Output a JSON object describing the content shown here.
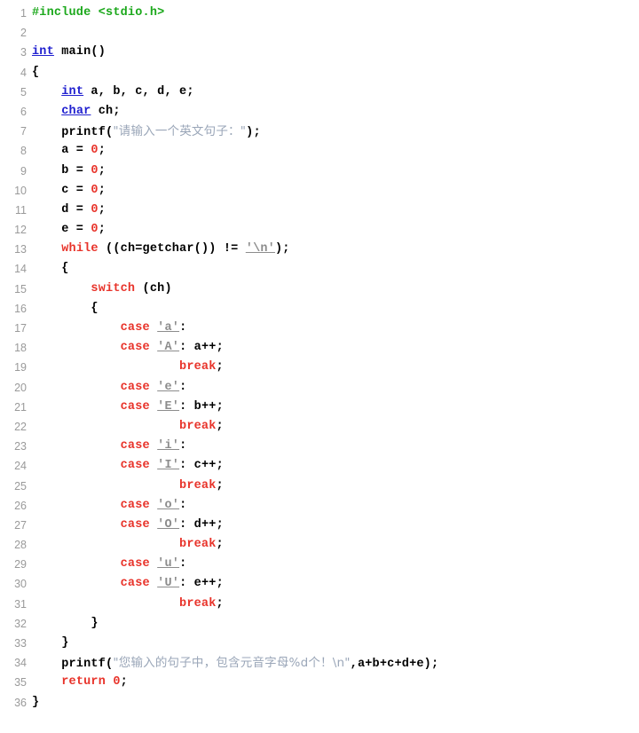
{
  "editor": {
    "language": "C",
    "title": "C Source Code Listing",
    "total_lines": 36,
    "colors": {
      "background": "#ffffff",
      "line_number": "#9a9a9a",
      "preprocessor": "#1ba81b",
      "type_keyword": "#2020cf",
      "control_keyword": "#e8332a",
      "number_literal": "#e8332a",
      "string_literal": "#9aa6b8",
      "char_literal": "#8c8c8c",
      "plain_text": "#000000"
    }
  },
  "lines": [
    {
      "n": "1",
      "tokens": [
        {
          "t": "#include <stdio.h>",
          "c": "t-pre"
        }
      ]
    },
    {
      "n": "2",
      "tokens": []
    },
    {
      "n": "3",
      "tokens": [
        {
          "t": "int",
          "c": "t-kw"
        },
        {
          "t": " main()",
          "c": "t-plain"
        }
      ]
    },
    {
      "n": "4",
      "tokens": [
        {
          "t": "{",
          "c": "t-plain"
        }
      ]
    },
    {
      "n": "5",
      "tokens": [
        {
          "t": "    ",
          "c": "t-plain"
        },
        {
          "t": "int",
          "c": "t-kw"
        },
        {
          "t": " a, b, c, d, e;",
          "c": "t-plain"
        }
      ]
    },
    {
      "n": "6",
      "tokens": [
        {
          "t": "    ",
          "c": "t-plain"
        },
        {
          "t": "char",
          "c": "t-kw"
        },
        {
          "t": " ch;",
          "c": "t-plain"
        }
      ]
    },
    {
      "n": "7",
      "tokens": [
        {
          "t": "    printf(",
          "c": "t-plain"
        },
        {
          "t": "\"请输入一个英文句子：\"",
          "c": "t-str t-cjk"
        },
        {
          "t": ");",
          "c": "t-plain"
        }
      ]
    },
    {
      "n": "8",
      "tokens": [
        {
          "t": "    a = ",
          "c": "t-plain"
        },
        {
          "t": "0",
          "c": "t-num"
        },
        {
          "t": ";",
          "c": "t-plain"
        }
      ]
    },
    {
      "n": "9",
      "tokens": [
        {
          "t": "    b = ",
          "c": "t-plain"
        },
        {
          "t": "0",
          "c": "t-num"
        },
        {
          "t": ";",
          "c": "t-plain"
        }
      ]
    },
    {
      "n": "10",
      "tokens": [
        {
          "t": "    c = ",
          "c": "t-plain"
        },
        {
          "t": "0",
          "c": "t-num"
        },
        {
          "t": ";",
          "c": "t-plain"
        }
      ]
    },
    {
      "n": "11",
      "tokens": [
        {
          "t": "    d = ",
          "c": "t-plain"
        },
        {
          "t": "0",
          "c": "t-num"
        },
        {
          "t": ";",
          "c": "t-plain"
        }
      ]
    },
    {
      "n": "12",
      "tokens": [
        {
          "t": "    e = ",
          "c": "t-plain"
        },
        {
          "t": "0",
          "c": "t-num"
        },
        {
          "t": ";",
          "c": "t-plain"
        }
      ]
    },
    {
      "n": "13",
      "tokens": [
        {
          "t": "    ",
          "c": "t-plain"
        },
        {
          "t": "while",
          "c": "t-ctl"
        },
        {
          "t": " ((ch=getchar()) != ",
          "c": "t-plain"
        },
        {
          "t": "'\\n'",
          "c": "t-chr"
        },
        {
          "t": ");",
          "c": "t-plain"
        }
      ]
    },
    {
      "n": "14",
      "tokens": [
        {
          "t": "    {",
          "c": "t-plain"
        }
      ]
    },
    {
      "n": "15",
      "tokens": [
        {
          "t": "        ",
          "c": "t-plain"
        },
        {
          "t": "switch",
          "c": "t-ctl"
        },
        {
          "t": " (ch)",
          "c": "t-plain"
        }
      ]
    },
    {
      "n": "16",
      "tokens": [
        {
          "t": "        {",
          "c": "t-plain"
        }
      ]
    },
    {
      "n": "17",
      "tokens": [
        {
          "t": "            ",
          "c": "t-plain"
        },
        {
          "t": "case",
          "c": "t-ctl"
        },
        {
          "t": " ",
          "c": "t-plain"
        },
        {
          "t": "'a'",
          "c": "t-chr"
        },
        {
          "t": ":",
          "c": "t-plain"
        }
      ]
    },
    {
      "n": "18",
      "tokens": [
        {
          "t": "            ",
          "c": "t-plain"
        },
        {
          "t": "case",
          "c": "t-ctl"
        },
        {
          "t": " ",
          "c": "t-plain"
        },
        {
          "t": "'A'",
          "c": "t-chr"
        },
        {
          "t": ": a++;",
          "c": "t-plain"
        }
      ]
    },
    {
      "n": "19",
      "tokens": [
        {
          "t": "                    ",
          "c": "t-plain"
        },
        {
          "t": "break",
          "c": "t-ctl"
        },
        {
          "t": ";",
          "c": "t-plain"
        }
      ]
    },
    {
      "n": "20",
      "tokens": [
        {
          "t": "            ",
          "c": "t-plain"
        },
        {
          "t": "case",
          "c": "t-ctl"
        },
        {
          "t": " ",
          "c": "t-plain"
        },
        {
          "t": "'e'",
          "c": "t-chr"
        },
        {
          "t": ":",
          "c": "t-plain"
        }
      ]
    },
    {
      "n": "21",
      "tokens": [
        {
          "t": "            ",
          "c": "t-plain"
        },
        {
          "t": "case",
          "c": "t-ctl"
        },
        {
          "t": " ",
          "c": "t-plain"
        },
        {
          "t": "'E'",
          "c": "t-chr"
        },
        {
          "t": ": b++;",
          "c": "t-plain"
        }
      ]
    },
    {
      "n": "22",
      "tokens": [
        {
          "t": "                    ",
          "c": "t-plain"
        },
        {
          "t": "break",
          "c": "t-ctl"
        },
        {
          "t": ";",
          "c": "t-plain"
        }
      ]
    },
    {
      "n": "23",
      "tokens": [
        {
          "t": "            ",
          "c": "t-plain"
        },
        {
          "t": "case",
          "c": "t-ctl"
        },
        {
          "t": " ",
          "c": "t-plain"
        },
        {
          "t": "'i'",
          "c": "t-chr"
        },
        {
          "t": ":",
          "c": "t-plain"
        }
      ]
    },
    {
      "n": "24",
      "tokens": [
        {
          "t": "            ",
          "c": "t-plain"
        },
        {
          "t": "case",
          "c": "t-ctl"
        },
        {
          "t": " ",
          "c": "t-plain"
        },
        {
          "t": "'I'",
          "c": "t-chr"
        },
        {
          "t": ": c++;",
          "c": "t-plain"
        }
      ]
    },
    {
      "n": "25",
      "tokens": [
        {
          "t": "                    ",
          "c": "t-plain"
        },
        {
          "t": "break",
          "c": "t-ctl"
        },
        {
          "t": ";",
          "c": "t-plain"
        }
      ]
    },
    {
      "n": "26",
      "tokens": [
        {
          "t": "            ",
          "c": "t-plain"
        },
        {
          "t": "case",
          "c": "t-ctl"
        },
        {
          "t": " ",
          "c": "t-plain"
        },
        {
          "t": "'o'",
          "c": "t-chr"
        },
        {
          "t": ":",
          "c": "t-plain"
        }
      ]
    },
    {
      "n": "27",
      "tokens": [
        {
          "t": "            ",
          "c": "t-plain"
        },
        {
          "t": "case",
          "c": "t-ctl"
        },
        {
          "t": " ",
          "c": "t-plain"
        },
        {
          "t": "'O'",
          "c": "t-chr"
        },
        {
          "t": ": d++;",
          "c": "t-plain"
        }
      ]
    },
    {
      "n": "28",
      "tokens": [
        {
          "t": "                    ",
          "c": "t-plain"
        },
        {
          "t": "break",
          "c": "t-ctl"
        },
        {
          "t": ";",
          "c": "t-plain"
        }
      ]
    },
    {
      "n": "29",
      "tokens": [
        {
          "t": "            ",
          "c": "t-plain"
        },
        {
          "t": "case",
          "c": "t-ctl"
        },
        {
          "t": " ",
          "c": "t-plain"
        },
        {
          "t": "'u'",
          "c": "t-chr"
        },
        {
          "t": ":",
          "c": "t-plain"
        }
      ]
    },
    {
      "n": "30",
      "tokens": [
        {
          "t": "            ",
          "c": "t-plain"
        },
        {
          "t": "case",
          "c": "t-ctl"
        },
        {
          "t": " ",
          "c": "t-plain"
        },
        {
          "t": "'U'",
          "c": "t-chr"
        },
        {
          "t": ": e++;",
          "c": "t-plain"
        }
      ]
    },
    {
      "n": "31",
      "tokens": [
        {
          "t": "                    ",
          "c": "t-plain"
        },
        {
          "t": "break",
          "c": "t-ctl"
        },
        {
          "t": ";",
          "c": "t-plain"
        }
      ]
    },
    {
      "n": "32",
      "tokens": [
        {
          "t": "        }",
          "c": "t-plain"
        }
      ]
    },
    {
      "n": "33",
      "tokens": [
        {
          "t": "    }",
          "c": "t-plain"
        }
      ]
    },
    {
      "n": "34",
      "tokens": [
        {
          "t": "    printf(",
          "c": "t-plain"
        },
        {
          "t": "\"您输入的句子中，包含元音字母%d个！\\n\"",
          "c": "t-str t-cjk"
        },
        {
          "t": ",a+b+c+d+e);",
          "c": "t-plain"
        }
      ]
    },
    {
      "n": "35",
      "tokens": [
        {
          "t": "    ",
          "c": "t-plain"
        },
        {
          "t": "return",
          "c": "t-ctl"
        },
        {
          "t": " ",
          "c": "t-plain"
        },
        {
          "t": "0",
          "c": "t-num"
        },
        {
          "t": ";",
          "c": "t-plain"
        }
      ]
    },
    {
      "n": "36",
      "tokens": [
        {
          "t": "}",
          "c": "t-plain"
        }
      ]
    }
  ]
}
